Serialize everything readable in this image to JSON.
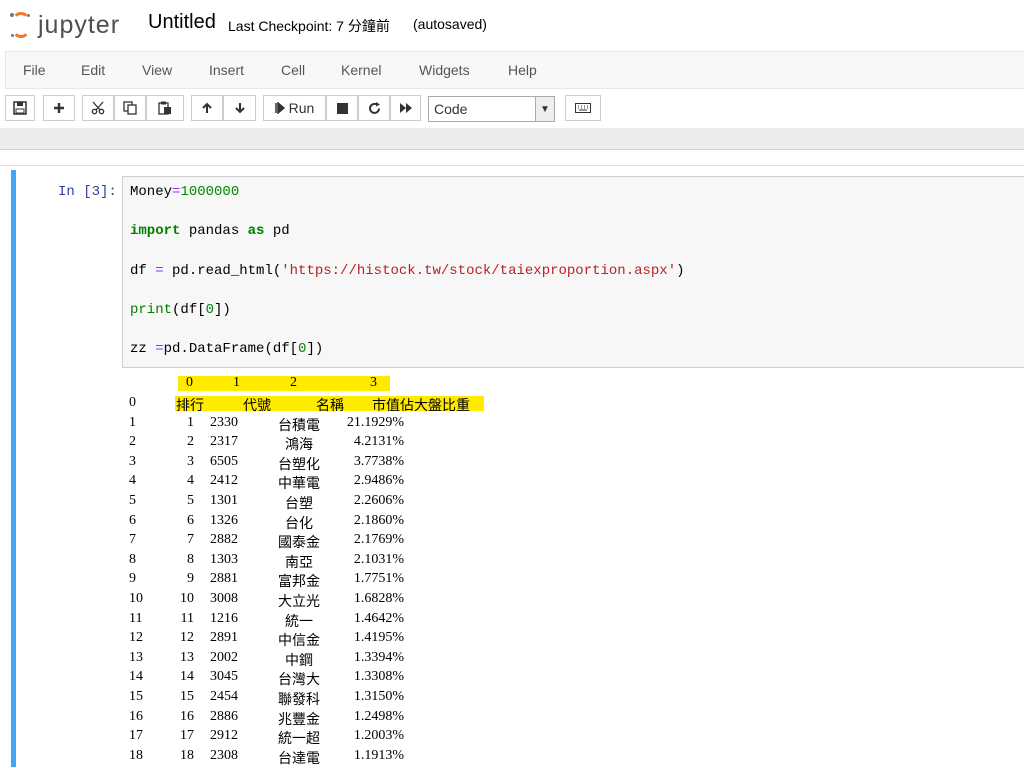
{
  "header": {
    "logo_text": "jupyter",
    "notebook_title": "Untitled",
    "checkpoint": "Last Checkpoint: 7 分鐘前",
    "autosaved": "(autosaved)"
  },
  "menu": [
    "File",
    "Edit",
    "View",
    "Insert",
    "Cell",
    "Kernel",
    "Widgets",
    "Help"
  ],
  "toolbar": {
    "run_label": "Run",
    "cell_type": "Code",
    "icons": [
      "save-icon",
      "plus-icon",
      "cut-icon",
      "copy-icon",
      "paste-icon",
      "arrow-up-icon",
      "arrow-down-icon",
      "run-icon",
      "stop-icon",
      "restart-icon",
      "fast-forward-icon",
      "keyboard-icon"
    ]
  },
  "cell": {
    "prompt": "In [3]:",
    "code": [
      "Money=1000000",
      "import pandas as pd",
      "df = pd.read_html('https://histock.tw/stock/taiexproportion.aspx')",
      "print(df[0])",
      "zz =pd.DataFrame(df[0])"
    ]
  },
  "output": {
    "header_cols": [
      "0",
      "1",
      "2",
      "3"
    ],
    "rows": [
      {
        "idx": "0",
        "c0": "排行",
        "c1": "代號",
        "c2": "名稱",
        "c3": "市值佔大盤比重"
      },
      {
        "idx": "1",
        "c0": "1",
        "c1": "2330",
        "c2": "台積電",
        "c3": "21.1929%"
      },
      {
        "idx": "2",
        "c0": "2",
        "c1": "2317",
        "c2": "鴻海",
        "c3": "4.2131%"
      },
      {
        "idx": "3",
        "c0": "3",
        "c1": "6505",
        "c2": "台塑化",
        "c3": "3.7738%"
      },
      {
        "idx": "4",
        "c0": "4",
        "c1": "2412",
        "c2": "中華電",
        "c3": "2.9486%"
      },
      {
        "idx": "5",
        "c0": "5",
        "c1": "1301",
        "c2": "台塑",
        "c3": "2.2606%"
      },
      {
        "idx": "6",
        "c0": "6",
        "c1": "1326",
        "c2": "台化",
        "c3": "2.1860%"
      },
      {
        "idx": "7",
        "c0": "7",
        "c1": "2882",
        "c2": "國泰金",
        "c3": "2.1769%"
      },
      {
        "idx": "8",
        "c0": "8",
        "c1": "1303",
        "c2": "南亞",
        "c3": "2.1031%"
      },
      {
        "idx": "9",
        "c0": "9",
        "c1": "2881",
        "c2": "富邦金",
        "c3": "1.7751%"
      },
      {
        "idx": "10",
        "c0": "10",
        "c1": "3008",
        "c2": "大立光",
        "c3": "1.6828%"
      },
      {
        "idx": "11",
        "c0": "11",
        "c1": "1216",
        "c2": "統一",
        "c3": "1.4642%"
      },
      {
        "idx": "12",
        "c0": "12",
        "c1": "2891",
        "c2": "中信金",
        "c3": "1.4195%"
      },
      {
        "idx": "13",
        "c0": "13",
        "c1": "2002",
        "c2": "中鋼",
        "c3": "1.3394%"
      },
      {
        "idx": "14",
        "c0": "14",
        "c1": "3045",
        "c2": "台灣大",
        "c3": "1.3308%"
      },
      {
        "idx": "15",
        "c0": "15",
        "c1": "2454",
        "c2": "聯發科",
        "c3": "1.3150%"
      },
      {
        "idx": "16",
        "c0": "16",
        "c1": "2886",
        "c2": "兆豐金",
        "c3": "1.2498%"
      },
      {
        "idx": "17",
        "c0": "17",
        "c1": "2912",
        "c2": "統一超",
        "c3": "1.2003%"
      },
      {
        "idx": "18",
        "c0": "18",
        "c1": "2308",
        "c2": "台達電",
        "c3": "1.1913%"
      }
    ]
  },
  "colors": {
    "accent": "#f37726",
    "cell_border": "#42a5f5",
    "highlight": "#ffeb00",
    "prompt": "#303f9f"
  }
}
